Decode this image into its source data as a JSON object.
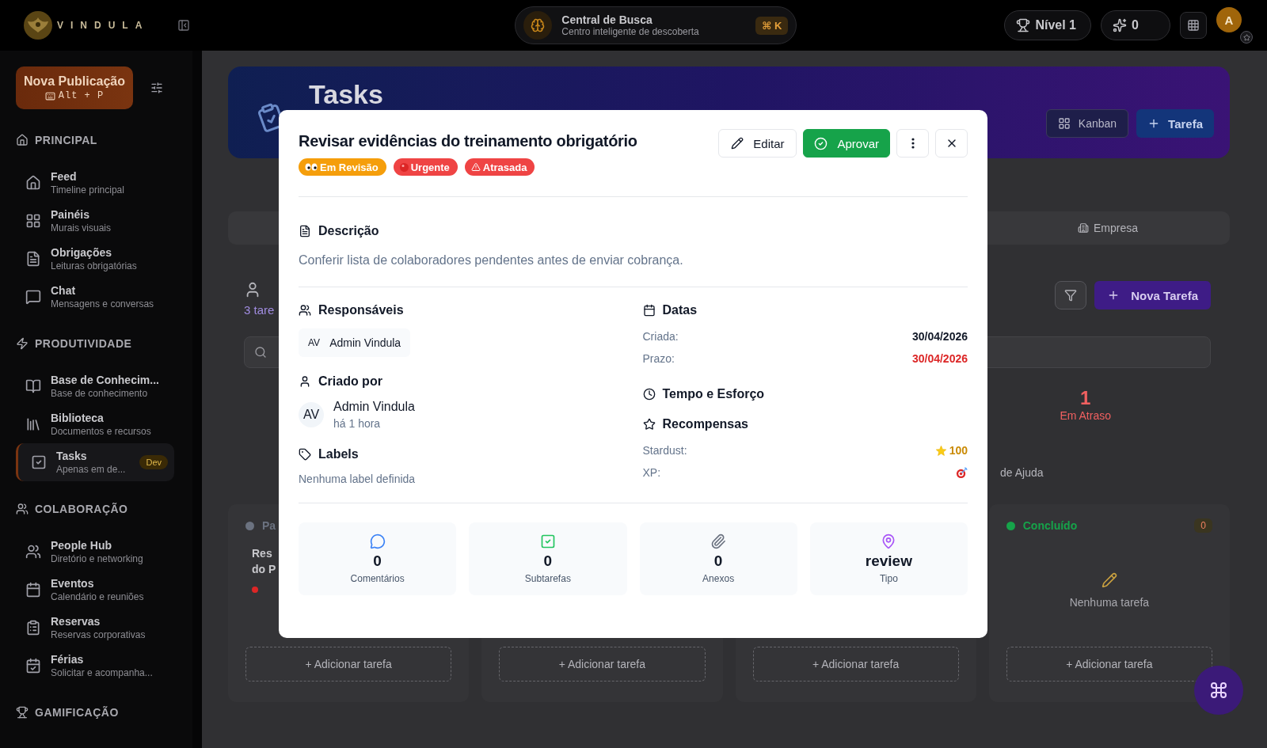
{
  "topbar": {
    "brand": "VINDULA",
    "search": {
      "title": "Central de Busca",
      "subtitle": "Centro inteligente de descoberta",
      "shortcut": "⌘ K"
    },
    "level": "Nível 1",
    "points": "0",
    "avatar": "A"
  },
  "sidebar": {
    "new_post": {
      "label": "Nova Publicação",
      "shortcut": "Alt + P"
    },
    "sections": [
      {
        "title": "PRINCIPAL",
        "items": [
          {
            "title": "Feed",
            "subtitle": "Timeline principal",
            "selected": false
          },
          {
            "title": "Painéis",
            "subtitle": "Murais visuais",
            "selected": false
          },
          {
            "title": "Obrigações",
            "subtitle": "Leituras obrigatórias",
            "selected": false
          },
          {
            "title": "Chat",
            "subtitle": "Mensagens e conversas",
            "selected": false
          }
        ]
      },
      {
        "title": "PRODUTIVIDADE",
        "items": [
          {
            "title": "Base de Conhecim...",
            "subtitle": "Base de conhecimento",
            "selected": false
          },
          {
            "title": "Biblioteca",
            "subtitle": "Documentos e recursos",
            "selected": false
          },
          {
            "title": "Tasks",
            "subtitle": "Apenas em de...",
            "badge": "Dev",
            "selected": true
          }
        ]
      },
      {
        "title": "COLABORAÇÃO",
        "items": [
          {
            "title": "People Hub",
            "subtitle": "Diretório e networking",
            "selected": false
          },
          {
            "title": "Eventos",
            "subtitle": "Calendário e reuniões",
            "selected": false
          },
          {
            "title": "Reservas",
            "subtitle": "Reservas corporativas",
            "selected": false
          },
          {
            "title": "Férias",
            "subtitle": "Solicitar e acompanha...",
            "selected": false
          }
        ]
      },
      {
        "title": "GAMIFICAÇÃO"
      }
    ]
  },
  "page": {
    "banner": {
      "title": "Tasks",
      "view_button": "Kanban",
      "add_button": "Tarefa"
    },
    "tabs": [
      {
        "label": "Empresa",
        "selected": false
      }
    ],
    "header": {
      "count": "3 tare",
      "new_task": "Nova Tarefa"
    },
    "stats": [
      {
        "value": "1",
        "label": "Em Atraso"
      }
    ],
    "help_link": "de Ajuda",
    "columns": [
      {
        "title": "Pa",
        "color": "#6b7280",
        "cards": [
          {
            "lines": [
              "Res",
              "do P"
            ],
            "color": "#dc2626"
          }
        ],
        "add": "+ Adicionar tarefa"
      },
      {
        "add": "+ Adicionar tarefa"
      },
      {
        "add": "+ Adicionar tarefa"
      },
      {
        "title": "Concluído",
        "color": "#16a34a",
        "count": "0",
        "empty": "Nenhuma tarefa",
        "add": "+ Adicionar tarefa"
      }
    ]
  },
  "modal": {
    "title": "Revisar evidências do treinamento obrigatório",
    "badges": [
      {
        "kind": "eyes",
        "label": "Em Revisão",
        "color": "#f59e0b"
      },
      {
        "kind": "dot",
        "label": "Urgente",
        "color": "#ef4444"
      },
      {
        "kind": "warning",
        "label": "Atrasada",
        "color": "#ef4444"
      }
    ],
    "edit_button": "Editar",
    "approve_button": "Aprovar",
    "description": {
      "title": "Descrição",
      "text": "Conferir lista de colaboradores pendentes antes de enviar cobrança."
    },
    "assignees": {
      "title": "Responsáveis",
      "people": [
        {
          "initials": "AV",
          "name": "Admin Vindula"
        }
      ]
    },
    "creator": {
      "title": "Criado por",
      "initials": "AV",
      "name": "Admin Vindula",
      "time": "há 1 hora"
    },
    "labels": {
      "title": "Labels",
      "empty": "Nenhuma label definida"
    },
    "dates": {
      "title": "Datas",
      "rows": [
        {
          "label": "Criada:",
          "value": "30/04/2026",
          "overdue": false
        },
        {
          "label": "Prazo:",
          "value": "30/04/2026",
          "overdue": true
        }
      ]
    },
    "effort": {
      "title": "Tempo e Esforço"
    },
    "rewards": {
      "title": "Recompensas",
      "rows": [
        {
          "kind": "star",
          "label": "Stardust:",
          "value": "100"
        },
        {
          "kind": "target",
          "label": "XP:"
        }
      ]
    },
    "stats": [
      {
        "kind": "comments",
        "value": "0",
        "label": "Comentários"
      },
      {
        "kind": "subtasks",
        "value": "0",
        "label": "Subtarefas"
      },
      {
        "kind": "attachments",
        "value": "0",
        "label": "Anexos"
      },
      {
        "kind": "type",
        "value": "review",
        "label": "Tipo"
      }
    ]
  }
}
